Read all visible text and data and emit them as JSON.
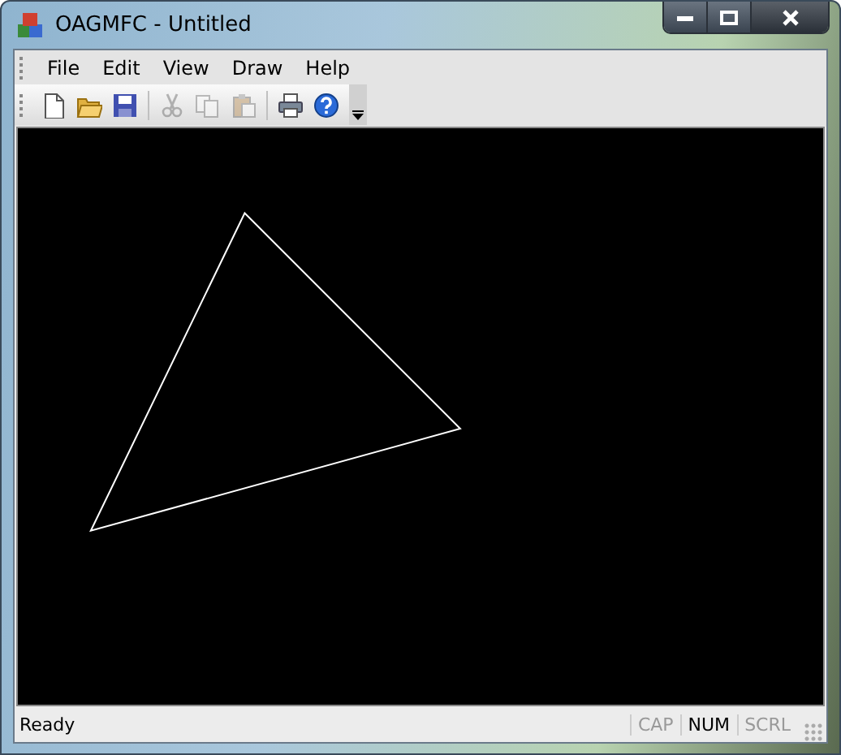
{
  "window": {
    "title": "OAGMFC - Untitled"
  },
  "menu": [
    "File",
    "Edit",
    "View",
    "Draw",
    "Help"
  ],
  "toolbar": [
    {
      "kind": "new",
      "disabled": false
    },
    {
      "kind": "open",
      "disabled": false
    },
    {
      "kind": "save",
      "disabled": false
    },
    {
      "kind": "sep"
    },
    {
      "kind": "cut",
      "disabled": true
    },
    {
      "kind": "copy",
      "disabled": true
    },
    {
      "kind": "paste",
      "disabled": true
    },
    {
      "kind": "sep"
    },
    {
      "kind": "print",
      "disabled": false
    },
    {
      "kind": "help",
      "disabled": false
    }
  ],
  "status_bar": {
    "text": "Ready",
    "indicators": [
      {
        "label": "CAP",
        "on": false
      },
      {
        "label": "NUM",
        "on": true
      },
      {
        "label": "SCRL",
        "on": false
      }
    ]
  }
}
